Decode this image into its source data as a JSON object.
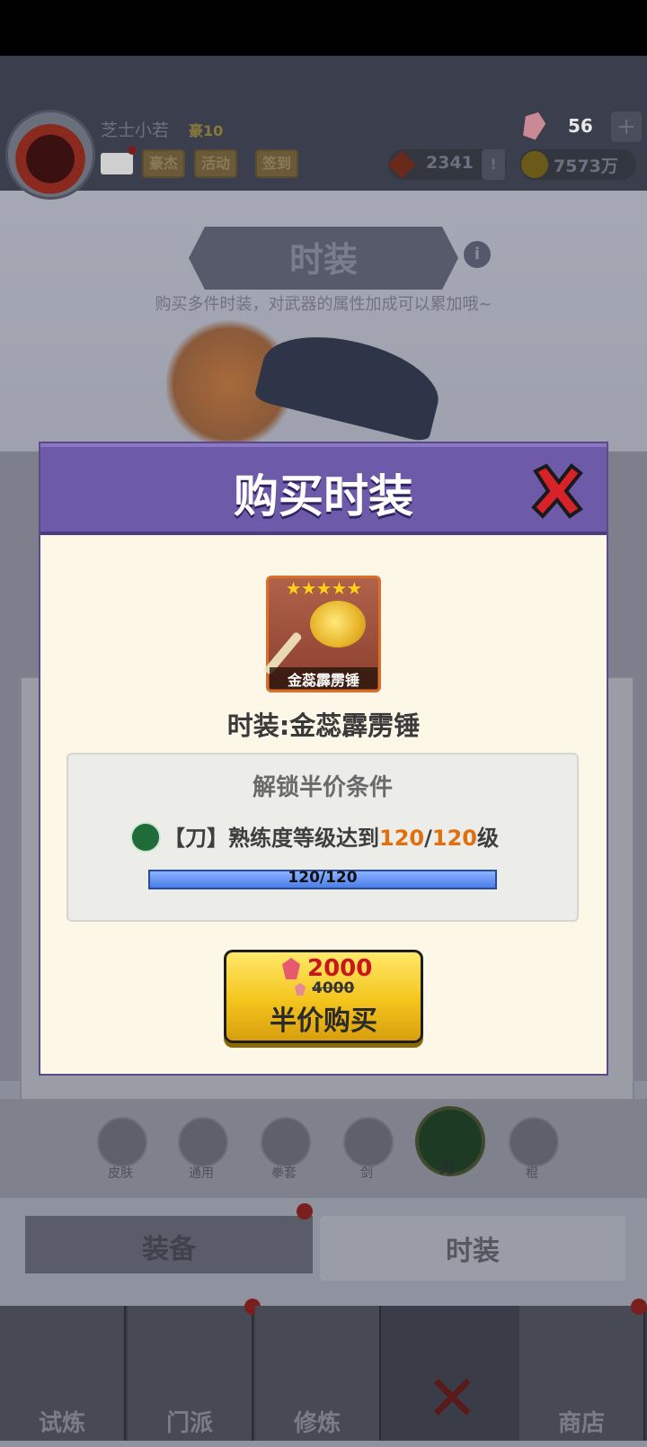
{
  "player": {
    "name": "芝士小若",
    "level": "豪10"
  },
  "header": {
    "buttons": [
      "豪杰",
      "活动",
      "签到"
    ],
    "gems": "56",
    "plus": "+",
    "honor": "2341",
    "honor_extra": "!",
    "coins": "7573万"
  },
  "screen": {
    "title": "时装",
    "info": "i",
    "subtitle": "购买多件时装，对武器的属性加成可以累加哦~"
  },
  "weapon_categories": [
    "皮肤",
    "通用",
    "拳套",
    "剑",
    "刀",
    "棍"
  ],
  "tabs": {
    "equipment": "装备",
    "costume": "时装"
  },
  "nav": [
    "试炼",
    "门派",
    "修炼",
    "商店"
  ],
  "modal": {
    "title": "购买时装",
    "item": {
      "rarity_stars": 5,
      "stars_text": "★★★★★",
      "short_name": "金蕊霹雳锤",
      "full_name": "时装:金蕊霹雳锤"
    },
    "condition": {
      "title": "解锁半价条件",
      "prefix": "【刀】熟练度等级达到",
      "current": "120",
      "slash": "/",
      "target": "120",
      "suffix": "级",
      "progress_label": "120/120",
      "progress_fraction": 1.0
    },
    "purchase": {
      "price": "2000",
      "original_price": "4000",
      "label": "半价购买"
    }
  },
  "colors": {
    "modal_header": "#6d5aa8",
    "highlight": "#e06f10",
    "price": "#c8161c",
    "button": "#f4c51c"
  },
  "icons": [
    "avatar",
    "mail-icon",
    "gem-icon",
    "honor-icon",
    "coin-icon",
    "info-icon",
    "close-icon",
    "blade-icon",
    "hammer-icon"
  ]
}
